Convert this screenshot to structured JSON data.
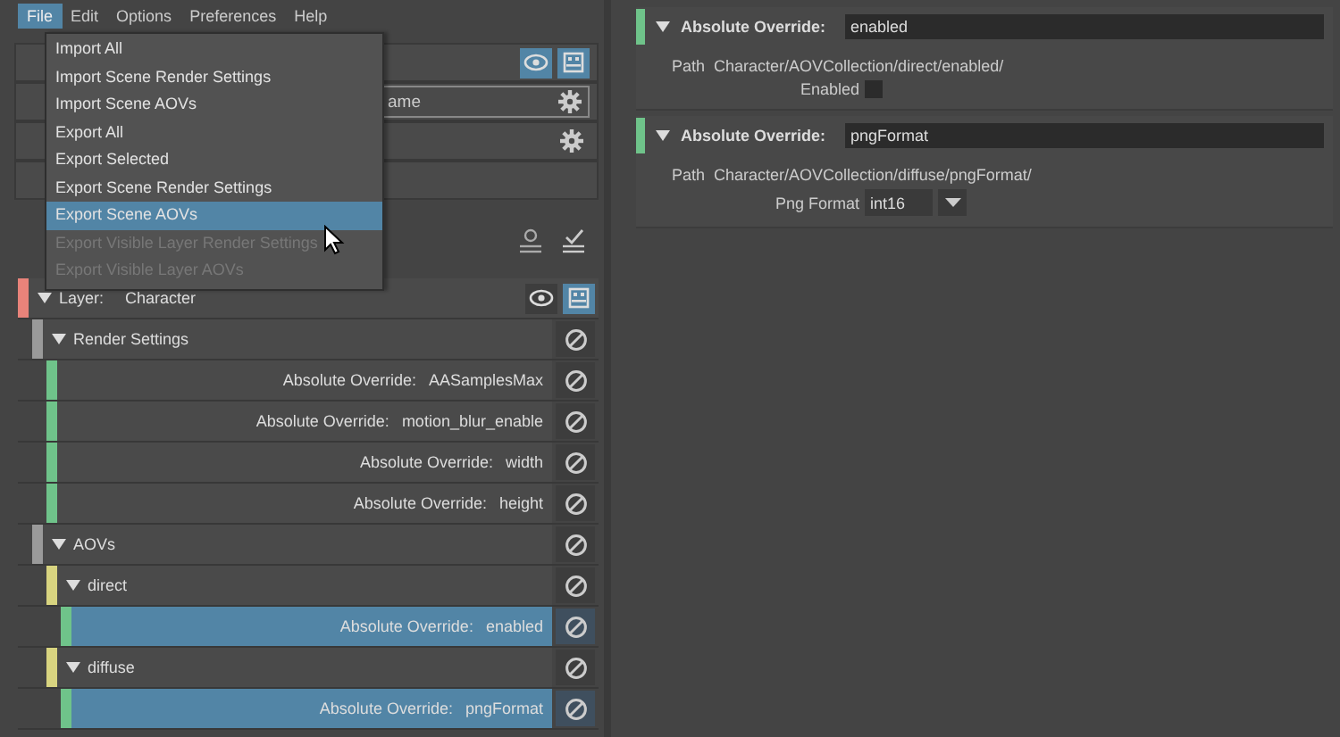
{
  "menu_bar": [
    {
      "label": "File",
      "selected": true
    },
    {
      "label": "Edit",
      "selected": false
    },
    {
      "label": "Options",
      "selected": false
    },
    {
      "label": "Preferences",
      "selected": false
    },
    {
      "label": "Help",
      "selected": false
    }
  ],
  "file_menu": [
    {
      "label": "Import All",
      "selected": false,
      "disabled": false
    },
    {
      "label": "Import Scene Render Settings",
      "selected": false,
      "disabled": false
    },
    {
      "label": "Import Scene AOVs",
      "selected": false,
      "disabled": false
    },
    {
      "label": "Export All",
      "selected": false,
      "disabled": false
    },
    {
      "label": "Export Selected",
      "selected": false,
      "disabled": false
    },
    {
      "label": "Export Scene Render Settings",
      "selected": false,
      "disabled": false
    },
    {
      "label": "Export Scene AOVs",
      "selected": true,
      "disabled": false
    },
    {
      "label": "Export Visible Layer Render Settings",
      "selected": false,
      "disabled": true
    },
    {
      "label": "Export Visible Layer AOVs",
      "selected": false,
      "disabled": true
    }
  ],
  "top_panel": {
    "name_field": "ame"
  },
  "tree": [
    {
      "kind": "layer",
      "label": "Layer:",
      "name": "Character",
      "expanded": true,
      "color": "#e8837a",
      "selected": false,
      "children": [
        {
          "kind": "collection",
          "name": "Render Settings",
          "expanded": true,
          "color": "#9a9a9a",
          "selected": false,
          "children": [
            {
              "kind": "override",
              "label": "Absolute Override:",
              "name": "AASamplesMax",
              "color": "#6fc38a",
              "selected": false
            },
            {
              "kind": "override",
              "label": "Absolute Override:",
              "name": "motion_blur_enable",
              "color": "#6fc38a",
              "selected": false
            },
            {
              "kind": "override",
              "label": "Absolute Override:",
              "name": "width",
              "color": "#6fc38a",
              "selected": false
            },
            {
              "kind": "override",
              "label": "Absolute Override:",
              "name": "height",
              "color": "#6fc38a",
              "selected": false
            }
          ]
        },
        {
          "kind": "collection",
          "name": "AOVs",
          "expanded": true,
          "color": "#9a9a9a",
          "selected": false,
          "children": [
            {
              "kind": "collection",
              "name": "direct",
              "expanded": true,
              "color": "#d8d480",
              "selected": false,
              "children": [
                {
                  "kind": "override",
                  "label": "Absolute Override:",
                  "name": "enabled",
                  "color": "#6fc38a",
                  "selected": true
                }
              ]
            },
            {
              "kind": "collection",
              "name": "diffuse",
              "expanded": true,
              "color": "#d8d480",
              "selected": false,
              "children": [
                {
                  "kind": "override",
                  "label": "Absolute Override:",
                  "name": "pngFormat",
                  "color": "#6fc38a",
                  "selected": true
                }
              ]
            }
          ]
        }
      ]
    }
  ],
  "properties": [
    {
      "label": "Absolute Override:",
      "attribute": "enabled",
      "expanded": true,
      "path_label": "Path",
      "path": "Character/AOVCollection/direct/enabled/",
      "field": {
        "kind": "checkbox",
        "label": "Enabled",
        "checked": false
      }
    },
    {
      "label": "Absolute Override:",
      "attribute": "pngFormat",
      "expanded": true,
      "path_label": "Path",
      "path": "Character/AOVCollection/diffuse/pngFormat/",
      "field": {
        "kind": "dropdown",
        "label": "Png Format",
        "value": "int16"
      }
    }
  ]
}
